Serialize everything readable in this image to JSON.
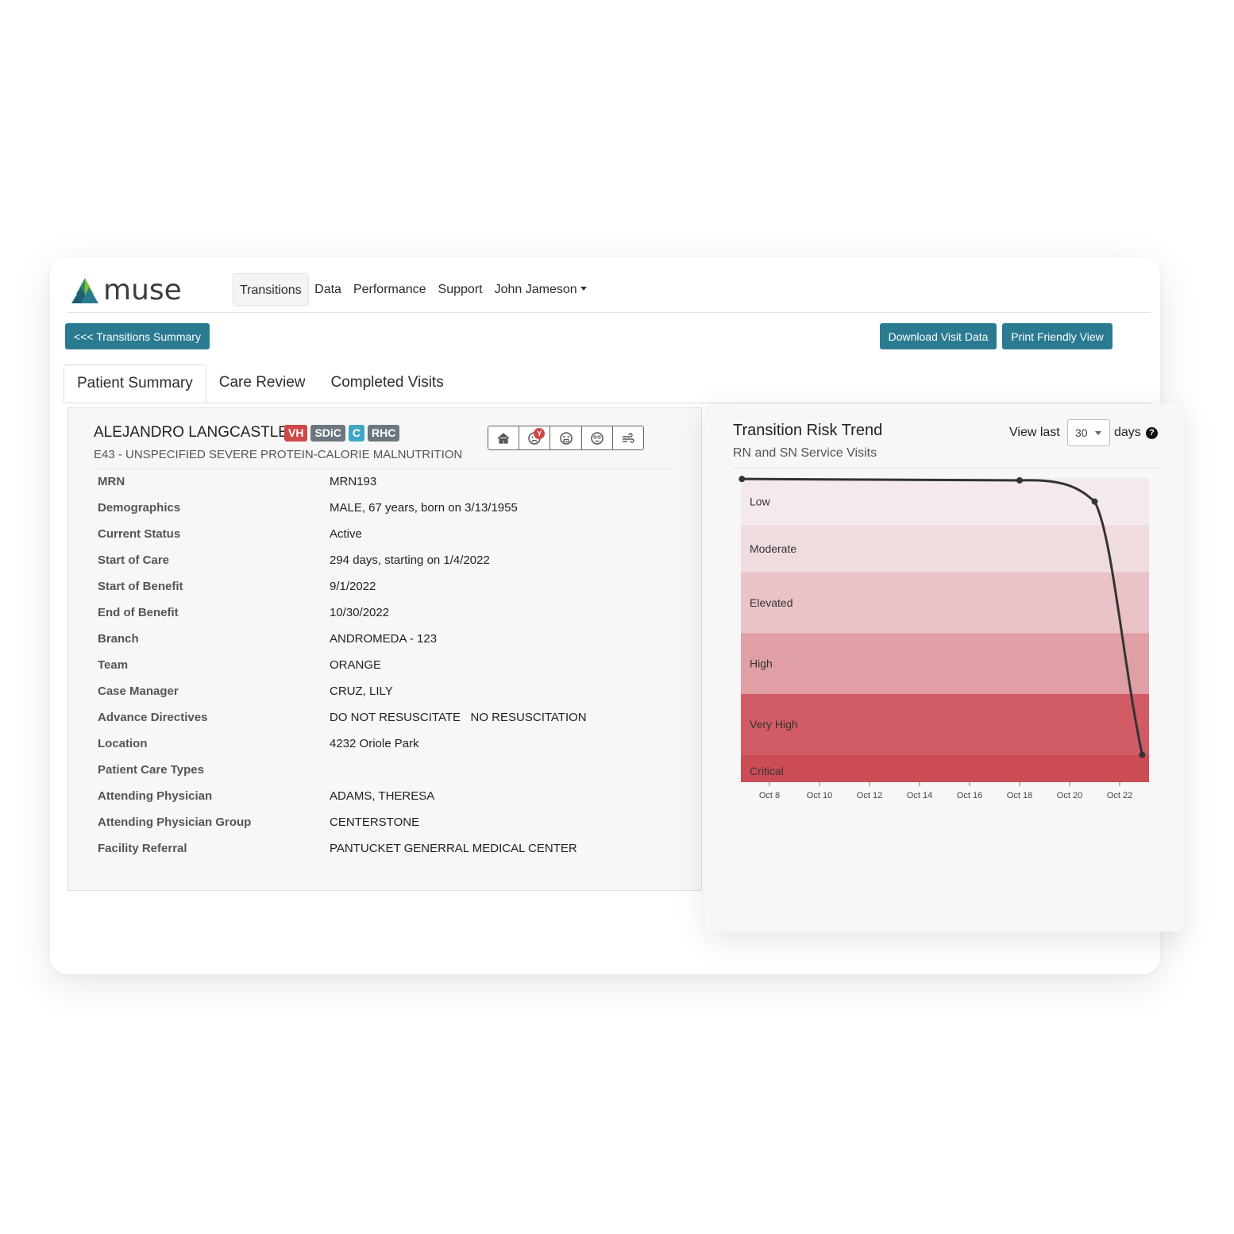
{
  "app": {
    "logo_text": "muse"
  },
  "nav": {
    "items": [
      "Transitions",
      "Data",
      "Performance",
      "Support"
    ],
    "user": "John Jameson"
  },
  "buttons": {
    "back": "<<< Transitions Summary",
    "download": "Download Visit Data",
    "print": "Print Friendly View"
  },
  "tabs": [
    "Patient Summary",
    "Care Review",
    "Completed Visits"
  ],
  "patient": {
    "name": "ALEJANDRO LANGCASTLE",
    "badges": [
      "VH",
      "SDiC",
      "C",
      "RHC"
    ],
    "diagnosis": "E43 - UNSPECIFIED SEVERE PROTEIN-CALORIE MALNUTRITION",
    "icons": [
      "home-icon",
      "sad-face-icon",
      "distressed-face-icon",
      "dizzy-face-icon",
      "wind-icon"
    ],
    "notification": "Y",
    "fields": [
      {
        "label": "MRN",
        "value": "MRN193"
      },
      {
        "label": "Demographics",
        "value": "MALE, 67 years, born on 3/13/1955"
      },
      {
        "label": "Current Status",
        "value": "Active"
      },
      {
        "label": "Start of Care",
        "value": "294 days, starting on 1/4/2022"
      },
      {
        "label": "Start of Benefit",
        "value": "9/1/2022"
      },
      {
        "label": "End of Benefit",
        "value": "10/30/2022"
      },
      {
        "label": "Branch",
        "value": "ANDROMEDA - 123"
      },
      {
        "label": "Team",
        "value": "ORANGE"
      },
      {
        "label": "Case Manager",
        "value": "CRUZ, LILY"
      },
      {
        "label": "Advance Directives",
        "value": "DO NOT RESUSCITATE   NO RESUSCITATION"
      },
      {
        "label": "Location",
        "value": "4232 Oriole Park"
      },
      {
        "label": "Patient Care Types",
        "value": ""
      },
      {
        "label": "Attending Physician",
        "value": "ADAMS, THERESA"
      },
      {
        "label": "Attending Physician Group",
        "value": "CENTERSTONE"
      },
      {
        "label": "Facility Referral",
        "value": "PANTUCKET GENERRAL MEDICAL CENTER"
      }
    ]
  },
  "trend": {
    "title": "Transition Risk Trend",
    "subtitle": "RN and SN Service Visits",
    "view_last_label": "View last",
    "days_value": "30",
    "days_label": "days",
    "help": "?"
  },
  "colors": {
    "accent": "#2a7b91",
    "badge_red": "#cf4848",
    "badge_gray": "#6d7680",
    "badge_teal": "#3ea8c4"
  },
  "chart_data": {
    "type": "line",
    "title": "Transition Risk Trend",
    "subtitle": "RN and SN Service Visits",
    "x_ticks": [
      "Oct 8",
      "Oct 10",
      "Oct 12",
      "Oct 14",
      "Oct 16",
      "Oct 18",
      "Oct 20",
      "Oct 22"
    ],
    "bands": [
      {
        "label": "Low",
        "color": "#f4e9eb"
      },
      {
        "label": "Moderate",
        "color": "#f0dcdf"
      },
      {
        "label": "Elevated",
        "color": "#e9c3c7"
      },
      {
        "label": "High",
        "color": "#e09fa5"
      },
      {
        "label": "Very High",
        "color": "#d15c66"
      },
      {
        "label": "Critical",
        "color": "#cc4c55"
      }
    ],
    "ylim": [
      0,
      6
    ],
    "series": [
      {
        "points": [
          {
            "x": 6.9,
            "y": 0.02
          },
          {
            "x": 18.0,
            "y": 0.05
          },
          {
            "x": 21.0,
            "y": 0.5
          },
          {
            "x": 22.9,
            "y": 5.0
          }
        ]
      }
    ],
    "grid": false
  }
}
